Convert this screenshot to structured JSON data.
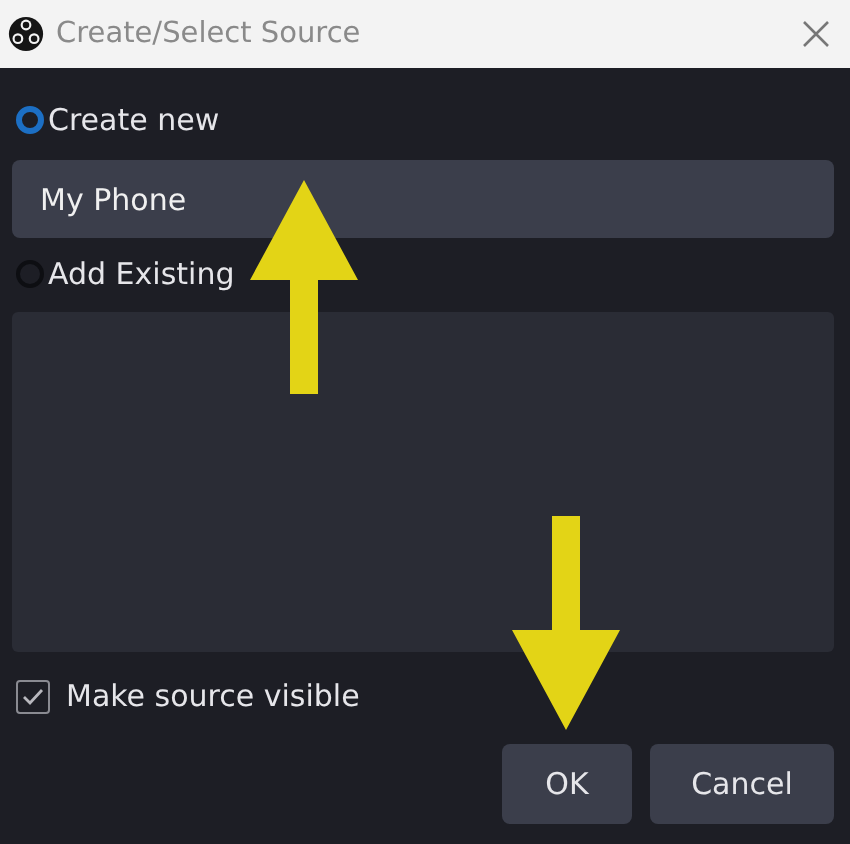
{
  "window": {
    "title": "Create/Select Source"
  },
  "options": [
    {
      "label": "Create new",
      "selected": true
    },
    {
      "label": "Add Existing",
      "selected": false
    }
  ],
  "name_field": {
    "value": "My Phone"
  },
  "make_visible": {
    "label": "Make source visible",
    "checked": true
  },
  "buttons": [
    "OK",
    "Cancel"
  ],
  "annotations": [
    {
      "kind": "up"
    },
    {
      "kind": "down"
    }
  ]
}
